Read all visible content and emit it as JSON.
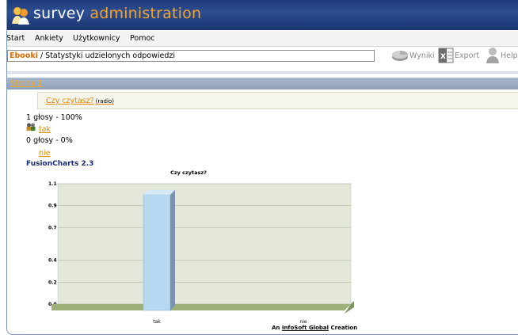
{
  "app": {
    "title_part1": "survey",
    "title_part2": "administration"
  },
  "menu": [
    "Start",
    "Ankiety",
    "Użytkownicy",
    "Pomoc"
  ],
  "breadcrumb": {
    "root": "Ebooki",
    "separator": " / ",
    "current": "Statystyki udzielonych odpowiedzi"
  },
  "toolbar": {
    "results_label": "Wyniki",
    "export_label": "Export",
    "help_label": "Help"
  },
  "page_link": "Strona 1",
  "question": {
    "text": "Czy czytasz?",
    "type": "(radio)"
  },
  "answers": [
    {
      "stat": "1 głosy - 100%",
      "label": "tak"
    },
    {
      "stat": "0 głosy - 0%",
      "label": "nie"
    }
  ],
  "chart_brand": "FusionCharts 2.3",
  "credit": {
    "prefix": "An",
    "brand": "InfoSoft Global",
    "suffix": "Creation"
  },
  "colors": {
    "title_bar": "#2c4f93",
    "accent_orange": "#f7a326",
    "link_orange": "#e08a00",
    "bar_fill": "#b6d8f0",
    "plot_bg": "#e3e8da"
  },
  "chart_data": {
    "type": "bar",
    "title": "Czy czytasz?",
    "categories": [
      "tak",
      "nie"
    ],
    "values": [
      1,
      0
    ],
    "ylim": [
      0,
      1.1
    ],
    "yticks": [
      "1.1",
      "0.9",
      "0.7",
      "0.4",
      "0.2",
      "0.0"
    ],
    "ytick_values": [
      1.1,
      0.9,
      0.7,
      0.4,
      0.2,
      0.0
    ],
    "grid": true
  }
}
